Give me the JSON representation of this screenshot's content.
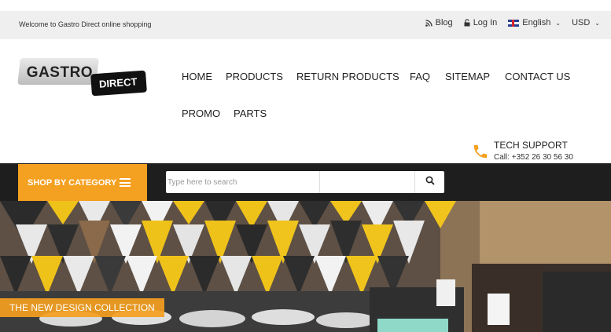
{
  "topbar": {
    "welcome": "Welcome to Gastro Direct online shopping",
    "blog": "Blog",
    "login": "Log In",
    "language": "English",
    "currency": "USD"
  },
  "logo": {
    "main": "GASTRO",
    "sub": "DIRECT"
  },
  "nav": {
    "items": [
      "HOME",
      "PRODUCTS",
      "RETURN PRODUCTS",
      "FAQ",
      "SITEMAP",
      "CONTACT US",
      "PROMO",
      "PARTS"
    ]
  },
  "tech_support": {
    "title": "TECH SUPPORT",
    "phone": "Call: +352 26 30 56 30"
  },
  "category_bar": {
    "shop_label": "SHOP BY CATEGORY",
    "search_placeholder": "Type here to search"
  },
  "banner": {
    "caption": "THE NEW DESIGN COLLECTION"
  },
  "colors": {
    "accent": "#f4a020",
    "dark_bar": "#1e1e1e",
    "topbar_bg": "#efefef"
  },
  "icons": [
    "rss-icon",
    "lock-icon",
    "uk-flag-icon",
    "chevron-down-icon",
    "phone-icon",
    "menu-icon",
    "search-icon"
  ]
}
